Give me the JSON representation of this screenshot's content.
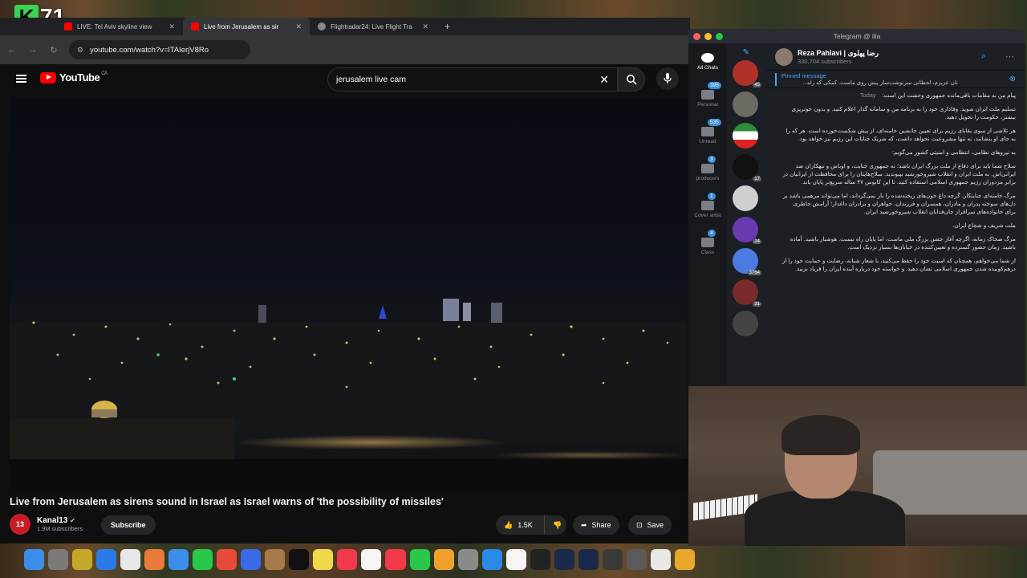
{
  "channel_bug": {
    "letter": "K",
    "number": "71"
  },
  "browser": {
    "tabs": [
      {
        "title": "LIVE: Tel Aviv skyline view",
        "fav_color": "#ff0000",
        "active": false
      },
      {
        "title": "Live from Jerusalem as sir",
        "fav_color": "#ff0000",
        "active": true
      },
      {
        "title": "Flightradar24: Live Flight Tra",
        "fav_color": "#888888",
        "active": false
      }
    ],
    "new_tab": "+",
    "url": "youtube.com/watch?v=lTAIerjV8Ro"
  },
  "youtube": {
    "logo": "YouTube",
    "region": "CA",
    "search_value": "jerusalem live cam",
    "video_title": "Live from Jerusalem as sirens sound in Israel as Israel warns of 'the possibility of missiles'",
    "channel": {
      "name": "Kanal13",
      "subscribers": "1.9M subscribers",
      "avatar_text": "13"
    },
    "subscribe_label": "Subscribe",
    "likes": "1.5K",
    "share_label": "Share",
    "save_label": "Save"
  },
  "telegram": {
    "window_title": "Telegram @ ilia",
    "folders": [
      {
        "label": "All Chats",
        "badge": ""
      },
      {
        "label": "Personal",
        "badge": "395"
      },
      {
        "label": "Unread",
        "badge": "535"
      },
      {
        "label": "producers",
        "badge": "3"
      },
      {
        "label": "Cover artist",
        "badge": "1"
      },
      {
        "label": "Class",
        "badge": "4"
      }
    ],
    "chat_avatars": [
      {
        "color": "#b0302a",
        "badge": "45"
      },
      {
        "color": "#6d6a64",
        "badge": ""
      },
      {
        "color": "#2e8b3a",
        "badge": ""
      },
      {
        "color": "#111111",
        "badge": "17"
      },
      {
        "color": "#cfcfcf",
        "badge": ""
      },
      {
        "color": "#6a3bb0",
        "badge": "24"
      },
      {
        "color": "#4b7be0",
        "badge": "3764"
      },
      {
        "color": "#7a2a2a",
        "badge": "31"
      },
      {
        "color": "#444444",
        "badge": ""
      }
    ],
    "channel_name": "Reza Pahlavi | رضا پهلوی",
    "channel_subs": "330,704 subscribers",
    "pinned_label": "Pinned message",
    "pinned_text": "نان عزیزم، لحظاتی سرنوشت‌ساز پیش روی ماست. کمکی که راه...",
    "today_label": "Today",
    "messages": [
      "پیام من به مقامات باقی‌مانده جمهوری وحشت این است:",
      "تسلیم ملت ایران شوید. وفاداری خود را به برنامه من و سامانه گذار اعلام کنید. و بدون خونریزی بیشتر، حکومت را تحویل دهید.",
      "هر تلاشی از سوی بقایای رژیم برای تعیین جانشین خامنه‌ای، از پیش شکست‌خورده است. هر که را به جای او بنشانند، نه تنها مشروعیت نخواهد داشت، که شریک جنایات این رژیم نیز خواهد بود.",
      "به نیروهای نظامی، انتظامی و امنیتی کشور می‌گویم:",
      "سلاح شما باید برای دفاع از ملت بزرگ ایران باشد؛ نه جمهوری جنایت، و اوباش و تبهکاران ضد ایرانی‌اش. به ملت ایران و انقلاب شیروخورشید بپیوندید. سلاح‌هایتان را برای محافظت از ایرانیان در برابر مزدوران رژیم جمهوری اسلامی استفاده کنید. تا این کابوس ۴۷ ساله سریع‌تر پایان یابد.",
      "مرگ خامنه‌ای جنایتکار، گرچه داغ خون‌های ریخته‌شده را باز نمی‌گرداند، اما می‌تواند مرهمی باشد بر دل‌های سوخته پدران و مادران، همسران و فرزندان، خواهران و برادران داغدار؛ آرامش خاطری برای خانواده‌های سرافراز جان‌فدایان انقلاب شیروخورشید ایران.",
      "ملت شریف و شجاع ایران،",
      "مرگ ضحاک زمانه، اگرچه آغاز جشن بزرگ ملی ماست، اما پایان راه نیست. هوشیار باشید. آماده باشید. زمان حضور گسترده و تعیین‌کننده در خیابان‌ها بسیار نزدیک است.",
      "از شما می‌خواهم، همچنان که امنیت خود را حفظ می‌کنید، با شعار شبانه، رضایت و حمایت خود را از درهم‌کوبیده شدن جمهوری اسلامی نشان دهید. و خواسته خود درباره آینده ایران را فریاد بزنید."
    ]
  },
  "dock": [
    {
      "name": "finder-icon",
      "color": "#3b8ee8"
    },
    {
      "name": "launchpad-icon",
      "color": "#7a7a7a"
    },
    {
      "name": "app-icon",
      "color": "#c4a82a"
    },
    {
      "name": "safari-icon",
      "color": "#2a7ae8"
    },
    {
      "name": "chrome-icon",
      "color": "#e8e8e8"
    },
    {
      "name": "photos-icon",
      "color": "#e87a3a"
    },
    {
      "name": "mail-icon",
      "color": "#3a8ee8"
    },
    {
      "name": "facetime-icon",
      "color": "#2ac84a"
    },
    {
      "name": "reminders-icon",
      "color": "#e84a3a"
    },
    {
      "name": "freeform-icon",
      "color": "#3a6ae8"
    },
    {
      "name": "app-icon",
      "color": "#a87a4a"
    },
    {
      "name": "tv-icon",
      "color": "#111111"
    },
    {
      "name": "notes-icon",
      "color": "#f0d84a"
    },
    {
      "name": "music-icon",
      "color": "#f03a4a"
    },
    {
      "name": "calendar-icon",
      "color": "#f5f5f5"
    },
    {
      "name": "news-icon",
      "color": "#f03a4a"
    },
    {
      "name": "numbers-icon",
      "color": "#2ac84a"
    },
    {
      "name": "pages-icon",
      "color": "#f0a02a"
    },
    {
      "name": "settings-icon",
      "color": "#8a8a8a"
    },
    {
      "name": "appstore-icon",
      "color": "#2a8ae8"
    },
    {
      "name": "notion-icon",
      "color": "#f5f5f5"
    },
    {
      "name": "app-icon",
      "color": "#222222"
    },
    {
      "name": "app-icon",
      "color": "#1a2a4a"
    },
    {
      "name": "app-icon",
      "color": "#1a2a4a"
    },
    {
      "name": "app-icon",
      "color": "#3a3a3a"
    },
    {
      "name": "app-icon",
      "color": "#5a5a5a"
    },
    {
      "name": "app-icon",
      "color": "#e8e8e8"
    },
    {
      "name": "app-icon",
      "color": "#e8a82a"
    }
  ]
}
